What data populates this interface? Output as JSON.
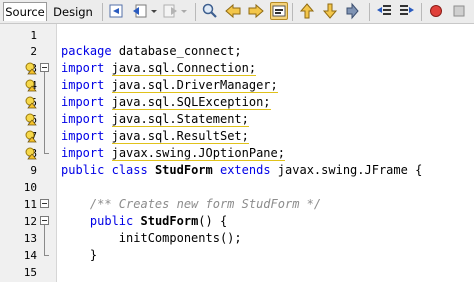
{
  "toolbar": {
    "tabs": [
      {
        "label": "Source",
        "active": true
      },
      {
        "label": "Design",
        "active": false
      }
    ],
    "buttons": [
      "last-edit-icon",
      "back-icon",
      "forward-icon",
      "find-icon",
      "find-previous-icon",
      "find-next-icon",
      "toggle-highlight-icon",
      "previous-bookmark-icon",
      "next-bookmark-icon",
      "toggle-bookmark-icon",
      "shift-left-icon",
      "shift-right-icon",
      "start-macro-icon",
      "stop-macro-icon"
    ]
  },
  "editor": {
    "lines": [
      {
        "n": "1",
        "text": ""
      },
      {
        "n": "2",
        "text": "package database_connect;"
      },
      {
        "n": "3",
        "text": "import java.sql.Connection;"
      },
      {
        "n": "4",
        "text": "import java.sql.DriverManager;"
      },
      {
        "n": "5",
        "text": "import java.sql.SQLException;"
      },
      {
        "n": "6",
        "text": "import java.sql.Statement;"
      },
      {
        "n": "7",
        "text": "import java.sql.ResultSet;"
      },
      {
        "n": "8",
        "text": "import javax.swing.JOptionPane;"
      },
      {
        "n": "9",
        "text": "public class StudForm extends javax.swing.JFrame {"
      },
      {
        "n": "10",
        "text": ""
      },
      {
        "n": "11",
        "text": "    /** Creates new form StudForm */"
      },
      {
        "n": "12",
        "text": "    public StudForm() {"
      },
      {
        "n": "13",
        "text": "        initComponents();"
      },
      {
        "n": "14",
        "text": "    }"
      },
      {
        "n": "15",
        "text": ""
      }
    ],
    "tokens": {
      "package": "package",
      "import": "import",
      "public": "public",
      "class": "class",
      "extends": "extends",
      "pkg_name": "database_connect;",
      "i3": "java.sql.Connection;",
      "i4": "java.sql.DriverManager;",
      "i5": "java.sql.SQLException;",
      "i6": "java.sql.Statement;",
      "i7": "java.sql.ResultSet;",
      "i8": "javax.swing.JOptionPane;",
      "class_name": "StudForm",
      "superclass": "javax.swing.JFrame {",
      "comment": "/** Creates new form StudForm */",
      "ctor_name": "StudForm",
      "ctor_rest": "() {",
      "init_call": "initComponents();",
      "close_brace": "}"
    }
  },
  "colors": {
    "keyword": "#0000e6",
    "comment": "#8c8c8c",
    "warning_underline": "#e0c21a",
    "toolbar_bg": "#ececec",
    "gutter_bg": "#f0f0f0"
  }
}
